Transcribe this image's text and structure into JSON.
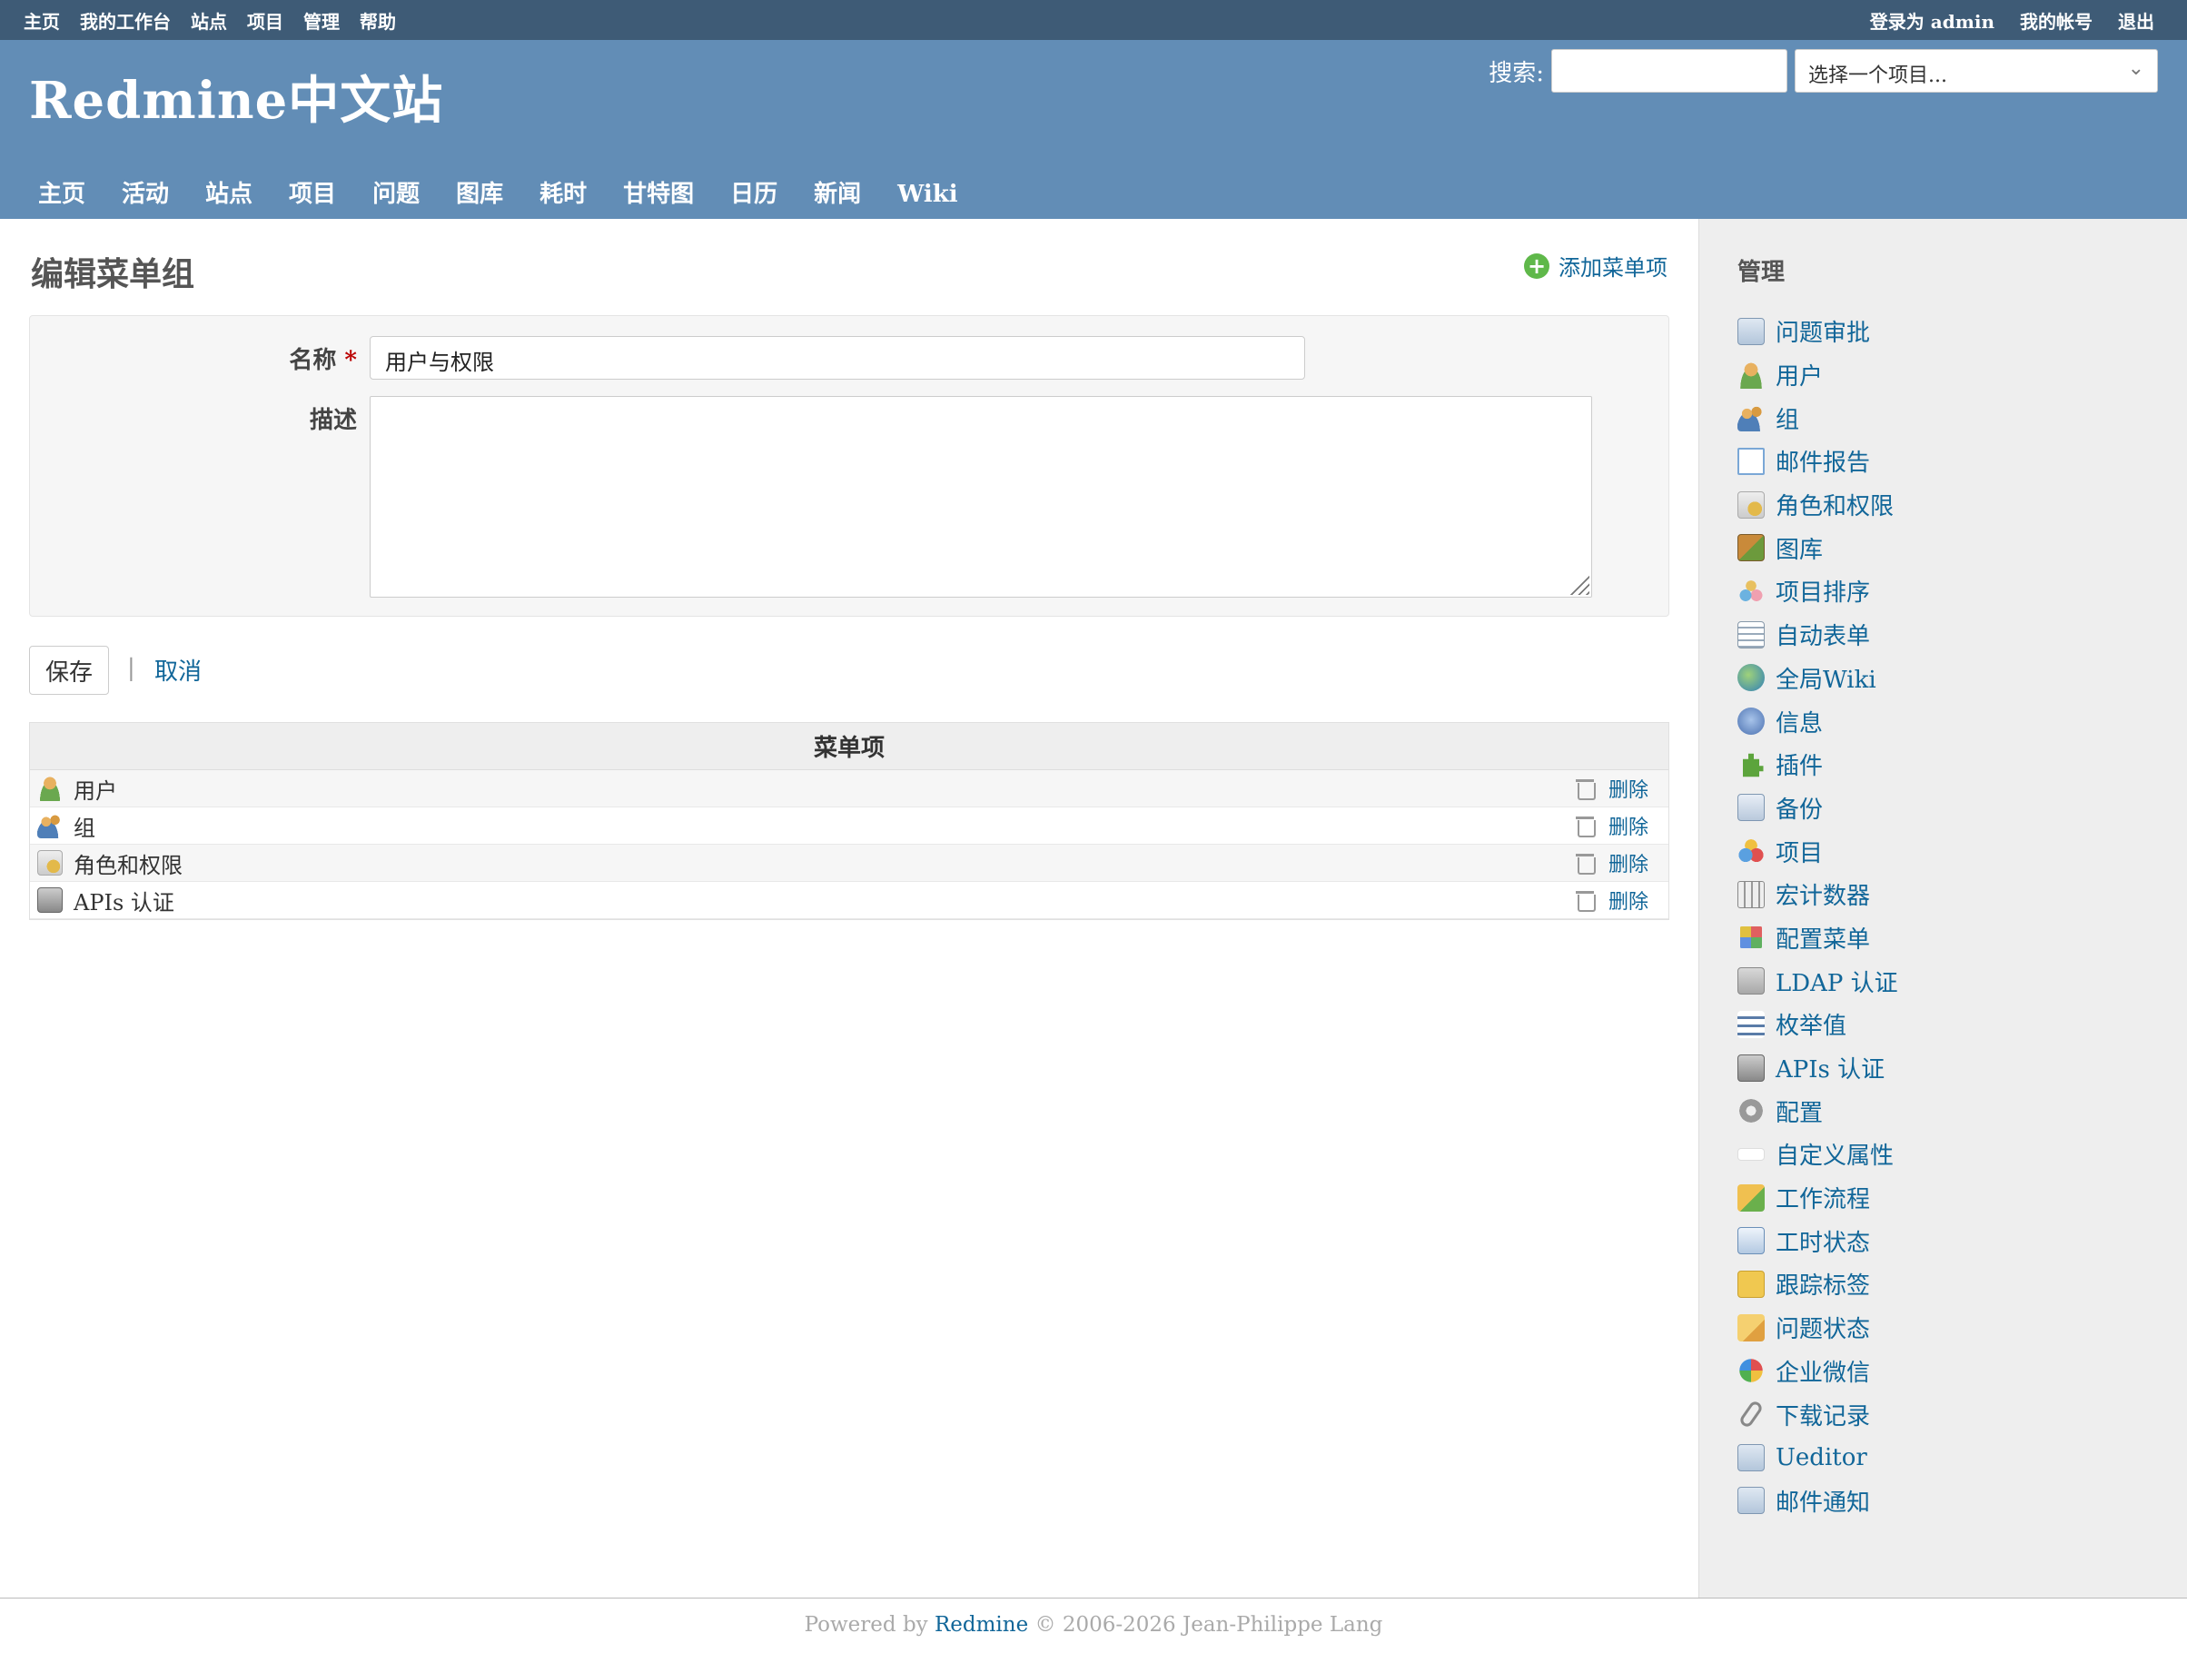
{
  "top_menu": {
    "left": [
      "主页",
      "我的工作台",
      "站点",
      "项目",
      "管理",
      "帮助"
    ],
    "login_prefix": "登录为",
    "login_user": "admin",
    "my_account": "我的帐号",
    "logout": "退出"
  },
  "header": {
    "site_title": "Redmine中文站",
    "search_label": "搜索:",
    "search_value": "",
    "project_select": "选择一个项目..."
  },
  "main_menu": [
    "主页",
    "活动",
    "站点",
    "项目",
    "问题",
    "图库",
    "耗时",
    "甘特图",
    "日历",
    "新闻",
    "Wiki"
  ],
  "content": {
    "page_title": "编辑菜单组",
    "add_link": "添加菜单项",
    "form": {
      "name_label": "名称",
      "required_mark": "*",
      "name_value": "用户与权限",
      "desc_label": "描述",
      "desc_value": ""
    },
    "save_button": "保存",
    "separator": "|",
    "cancel_link": "取消",
    "table": {
      "header": "菜单项",
      "delete_label": "删除",
      "rows": [
        {
          "label": "用户",
          "icon": "user-icon"
        },
        {
          "label": "组",
          "icon": "group-icon"
        },
        {
          "label": "角色和权限",
          "icon": "role-icon"
        },
        {
          "label": "APIs 认证",
          "icon": "api-icon"
        }
      ]
    }
  },
  "sidebar": {
    "title": "管理",
    "items": [
      {
        "label": "问题审批",
        "icon": "doc"
      },
      {
        "label": "用户",
        "icon": "user"
      },
      {
        "label": "组",
        "icon": "group"
      },
      {
        "label": "邮件报告",
        "icon": "mail"
      },
      {
        "label": "角色和权限",
        "icon": "role"
      },
      {
        "label": "图库",
        "icon": "gallery"
      },
      {
        "label": "项目排序",
        "icon": "sort"
      },
      {
        "label": "自动表单",
        "icon": "form"
      },
      {
        "label": "全局Wiki",
        "icon": "globe"
      },
      {
        "label": "信息",
        "icon": "info"
      },
      {
        "label": "插件",
        "icon": "plugin"
      },
      {
        "label": "备份",
        "icon": "backup"
      },
      {
        "label": "项目",
        "icon": "project"
      },
      {
        "label": "宏计数器",
        "icon": "calc"
      },
      {
        "label": "配置菜单",
        "icon": "grid"
      },
      {
        "label": "LDAP 认证",
        "icon": "ldap"
      },
      {
        "label": "枚举值",
        "icon": "list"
      },
      {
        "label": "APIs 认证",
        "icon": "api"
      },
      {
        "label": "配置",
        "icon": "gear"
      },
      {
        "label": "自定义属性",
        "icon": "custom"
      },
      {
        "label": "工作流程",
        "icon": "workflow"
      },
      {
        "label": "工时状态",
        "icon": "time"
      },
      {
        "label": "跟踪标签",
        "icon": "tag"
      },
      {
        "label": "问题状态",
        "icon": "status"
      },
      {
        "label": "企业微信",
        "icon": "wechat"
      },
      {
        "label": "下载记录",
        "icon": "clip"
      },
      {
        "label": "Ueditor",
        "icon": "doc"
      },
      {
        "label": "邮件通知",
        "icon": "doc"
      }
    ]
  },
  "footer": {
    "powered_by": "Powered by",
    "redmine": "Redmine",
    "copyright": "© 2006-2026 Jean-Philippe Lang"
  },
  "colors": {
    "top_bar": "#3e5b76",
    "header": "#628db6",
    "link": "#116699"
  }
}
